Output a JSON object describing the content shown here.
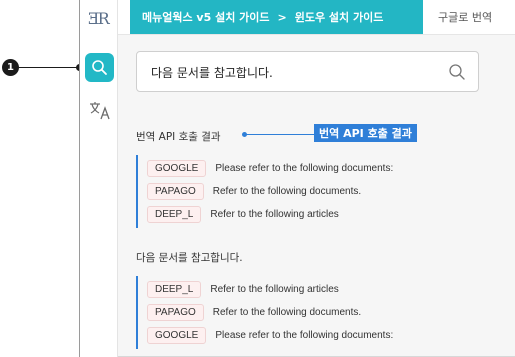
{
  "callout": {
    "number": "1"
  },
  "sidebar": {
    "logo": "ƎR"
  },
  "header": {
    "breadcrumb": [
      "메뉴얼웍스 v5 설치 가이드",
      "윈도우 설치 가이드"
    ],
    "separator": ">",
    "google_translate": "구글로 번역"
  },
  "search": {
    "value": "다음 문서를 참고합니다."
  },
  "sections": [
    {
      "title": "번역 API 호출 결과",
      "annotation": "번역 API 호출 결과",
      "results": [
        {
          "engine": "GOOGLE",
          "text": "Please refer to the following documents:"
        },
        {
          "engine": "PAPAGO",
          "text": "Refer to the following documents."
        },
        {
          "engine": "DEEP_L",
          "text": "Refer to the following articles"
        }
      ]
    },
    {
      "title": "다음 문서를 참고합니다.",
      "results": [
        {
          "engine": "DEEP_L",
          "text": "Refer to the following articles"
        },
        {
          "engine": "PAPAGO",
          "text": "Refer to the following documents."
        },
        {
          "engine": "GOOGLE",
          "text": "Please refer to the following documents:"
        }
      ]
    }
  ],
  "colors": {
    "accent": "#23b6c4",
    "annotation": "#2f7fd8"
  }
}
